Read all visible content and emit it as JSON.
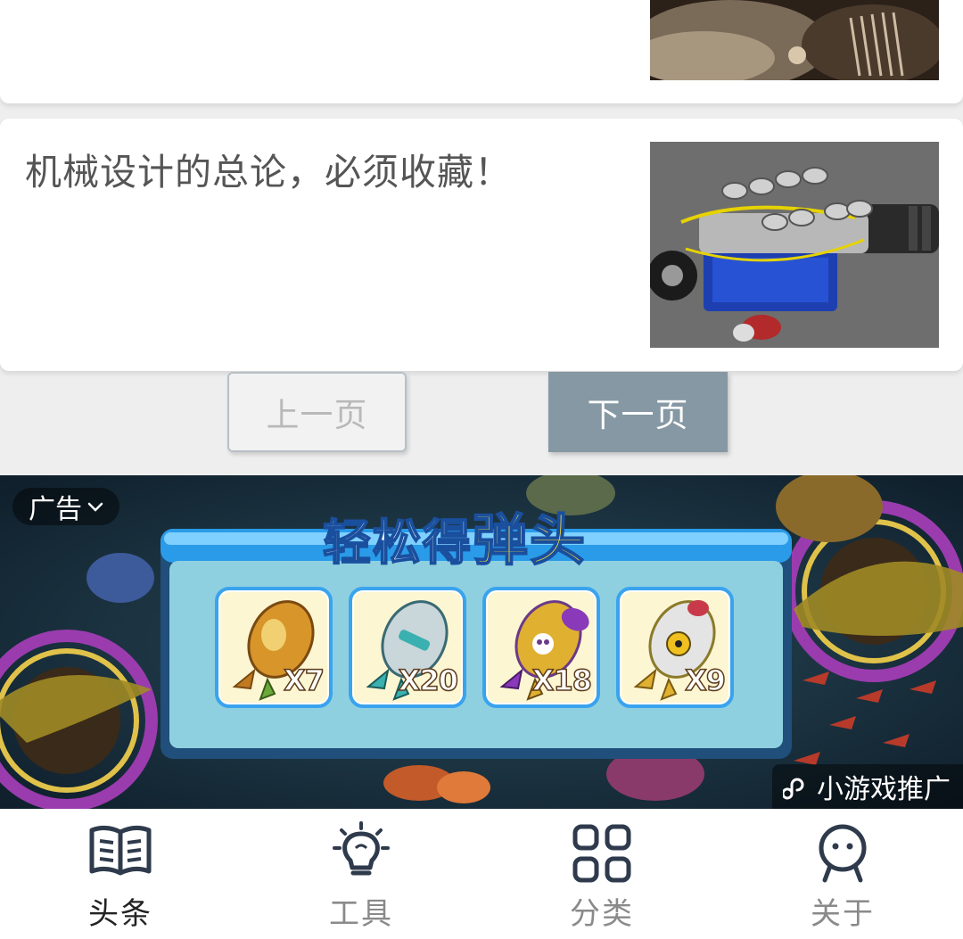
{
  "articles": [
    {
      "title": ""
    },
    {
      "title": "机械设计的总论，必须收藏！"
    }
  ],
  "pagination": {
    "prev_label": "上一页",
    "next_label": "下一页"
  },
  "ad": {
    "tag_label": "广告",
    "headline_part1": "轻松得",
    "headline_part2": "弹头",
    "items": [
      {
        "count": "X7",
        "icon": "gold-warhead-icon"
      },
      {
        "count": "X20",
        "icon": "silver-warhead-icon"
      },
      {
        "count": "X18",
        "icon": "purple-skull-warhead-icon"
      },
      {
        "count": "X9",
        "icon": "nuclear-warhead-icon"
      }
    ],
    "source_label": "小游戏推广"
  },
  "nav": {
    "items": [
      {
        "label": "头条",
        "icon": "book-icon",
        "active": true
      },
      {
        "label": "工具",
        "icon": "lightbulb-icon",
        "active": false
      },
      {
        "label": "分类",
        "icon": "grid-icon",
        "active": false
      },
      {
        "label": "关于",
        "icon": "person-icon",
        "active": false
      }
    ]
  },
  "colors": {
    "next_button_bg": "#8598a3",
    "active_nav_text": "#222222",
    "inactive_nav_text": "#8a8a8a",
    "nav_icon": "#2f3b4c"
  }
}
